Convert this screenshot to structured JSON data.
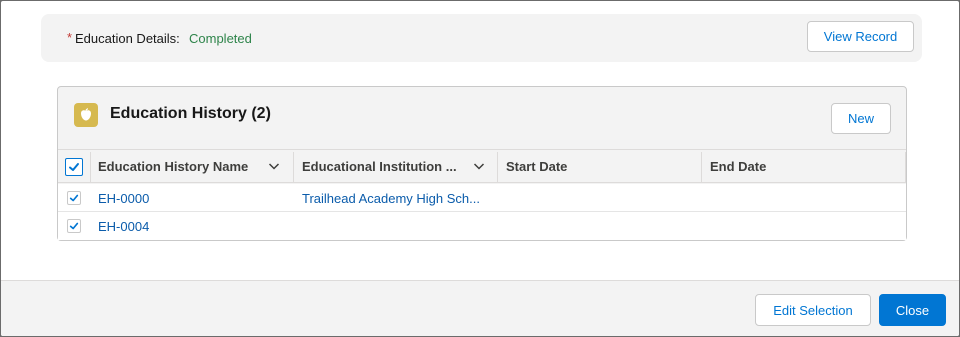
{
  "details": {
    "required_marker": "*",
    "label": "Education Details:",
    "status": "Completed",
    "view_record_label": "View Record"
  },
  "card": {
    "title": "Education History (2)",
    "icon": "education-icon",
    "new_label": "New"
  },
  "table": {
    "columns": [
      {
        "label": "Education History Name"
      },
      {
        "label": "Educational Institution ..."
      },
      {
        "label": "Start Date"
      },
      {
        "label": "End Date"
      }
    ],
    "rows": [
      {
        "name": "EH-0000",
        "institution": "Trailhead Academy High Sch...",
        "start": "",
        "end": "",
        "selected": true
      },
      {
        "name": "EH-0004",
        "institution": "",
        "start": "",
        "end": "",
        "selected": true
      }
    ],
    "all_selected": true
  },
  "footer": {
    "edit_selection_label": "Edit Selection",
    "close_label": "Close"
  },
  "colors": {
    "accent": "#0176d3",
    "success": "#2e844a",
    "required": "#c23934",
    "icon_bg": "#d6b94f"
  }
}
